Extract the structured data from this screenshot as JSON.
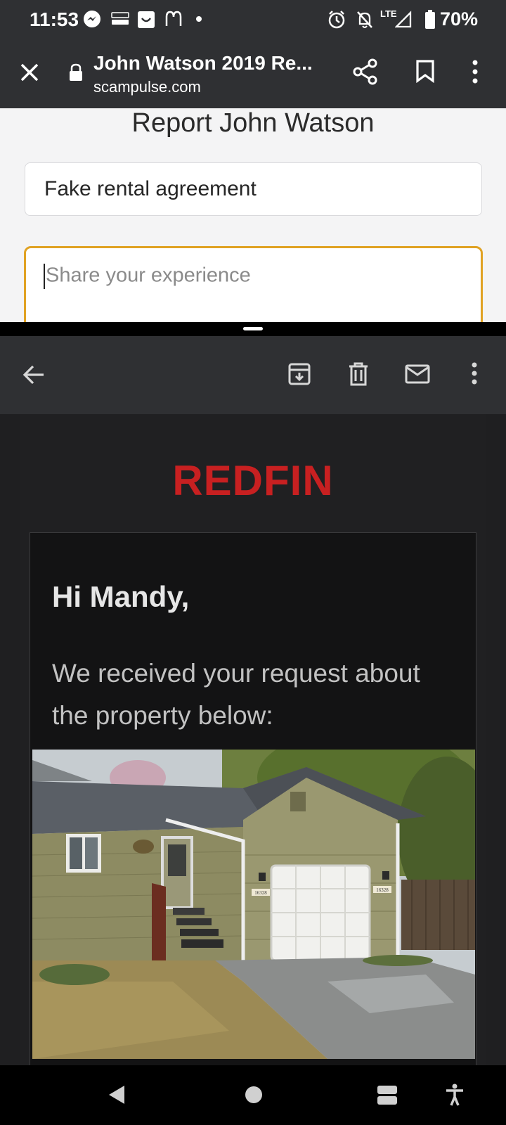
{
  "status_bar": {
    "time": "11:53",
    "network": "LTE",
    "battery": "70%",
    "icons": [
      "messenger-icon",
      "temu-icon",
      "shopping-bag-icon",
      "mcdonalds-icon",
      "dot-icon",
      "alarm-icon",
      "notifications-off-icon",
      "signal-icon",
      "battery-icon"
    ]
  },
  "browser": {
    "page_title": "John Watson 2019 Re...",
    "url": "scampulse.com",
    "icons": [
      "close-icon",
      "lock-icon",
      "share-icon",
      "bookmark-icon",
      "more-vert-icon"
    ]
  },
  "report_form": {
    "title": "Report John Watson",
    "reason_value": "Fake rental agreement",
    "experience_placeholder": "Share your experience",
    "accent_color": "#e0a223"
  },
  "mail_toolbar": {
    "icons": [
      "back-arrow-icon",
      "archive-icon",
      "delete-icon",
      "mark-unread-icon",
      "more-vert-icon"
    ]
  },
  "email": {
    "brand": "REDFIN",
    "brand_color": "#c82021",
    "greeting": "Hi Mandy,",
    "message": "We received your request about the property below:",
    "photo_house_numbers": [
      "16328",
      "16328"
    ]
  },
  "nav_bar": {
    "icons": [
      "back-triangle-icon",
      "home-circle-icon",
      "recents-icon",
      "accessibility-icon"
    ]
  }
}
